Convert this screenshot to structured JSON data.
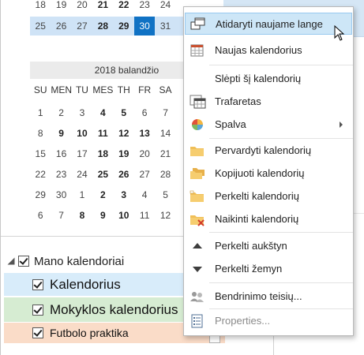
{
  "mini_calendar": {
    "prev_week_partial": [
      "18",
      "19",
      "20",
      "21",
      "22",
      "23",
      "24"
    ],
    "current_week": [
      "25",
      "26",
      "27",
      "28",
      "29",
      "30",
      "31"
    ],
    "month_title": "2018 balandžio",
    "weekday_headers": [
      "SU",
      "MEN",
      "TU",
      "MES",
      "TH",
      "FR",
      "SA"
    ],
    "weeks": [
      [
        "1",
        "2",
        "3",
        "4",
        "5",
        "6",
        "7"
      ],
      [
        "8",
        "9",
        "10",
        "11",
        "12",
        "13",
        "14"
      ],
      [
        "15",
        "16",
        "17",
        "18",
        "19",
        "20",
        "21"
      ],
      [
        "22",
        "23",
        "24",
        "25",
        "26",
        "27",
        "28"
      ],
      [
        "29",
        "30",
        "1",
        "2",
        "3",
        "4",
        "5"
      ],
      [
        "6",
        "7",
        "8",
        "9",
        "10",
        "11",
        "12"
      ]
    ]
  },
  "calendars": {
    "group_label": "Mano kalendoriai",
    "items": [
      {
        "label": "Kalendorius",
        "color": "#d8ecfa"
      },
      {
        "label": "Mokyklos kalendorius",
        "color": "#d6ecd2"
      },
      {
        "label": "Futbolo praktika",
        "color": "#fadcc8"
      }
    ]
  },
  "context_menu": {
    "items": [
      {
        "label": "Atidaryti naujame lange",
        "icon": "new-window-icon"
      },
      {
        "label": "Naujas kalendorius",
        "icon": "new-calendar-icon"
      },
      {
        "label": "Slėpti šį kalendorių",
        "icon": ""
      },
      {
        "label": "Trafaretas",
        "icon": "overlay-icon"
      },
      {
        "label": "Spalva",
        "icon": "color-palette-icon"
      },
      {
        "label": "Pervardyti kalendorių",
        "icon": "folder-icon"
      },
      {
        "label": "Kopijuoti kalendorių",
        "icon": "folder-copy-icon"
      },
      {
        "label": "Perkelti kalendorių",
        "icon": "folder-move-icon"
      },
      {
        "label": "Naikinti kalendorių",
        "icon": "folder-delete-icon"
      },
      {
        "label": "Perkelti aukštyn",
        "icon": "move-up-icon"
      },
      {
        "label": "Perkelti žemyn",
        "icon": "move-down-icon"
      },
      {
        "label": "Bendrinimo teisių...",
        "icon": "sharing-permissions-icon"
      },
      {
        "label": "Properties...",
        "icon": "properties-icon"
      }
    ]
  },
  "colors": {
    "accent": "#1072c4",
    "menu_highlight": "#cde6f7"
  }
}
